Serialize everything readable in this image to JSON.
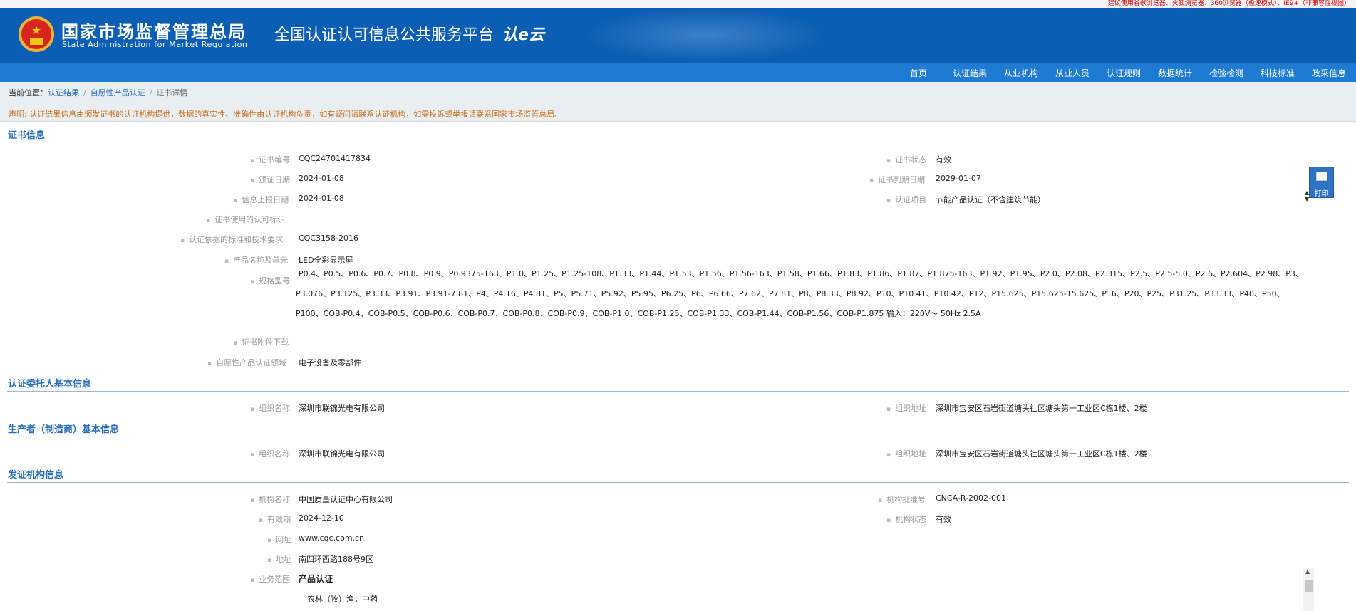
{
  "top_notice": "建议使用谷歌浏览器、火狐浏览器、360浏览器（极速模式）、IE9+（非兼容性视图）",
  "header": {
    "agency_cn": "国家市场监督管理总局",
    "agency_en": "State Administration for Market Regulation",
    "platform": "全国认证认可信息公共服务平台",
    "logo_text": "认e云"
  },
  "nav": [
    "首页",
    "认证结果",
    "从业机构",
    "从业人员",
    "认证规则",
    "数据统计",
    "检验检测",
    "科技标准",
    "政采信息"
  ],
  "breadcrumb": {
    "prefix": "当前位置：",
    "items": [
      "认证结果",
      "自愿性产品认证",
      "证书详情"
    ]
  },
  "declaration": "声明: 认证结果信息由颁发证书的认证机构提供，数据的真实性、准确性由认证机构负责，如有疑问请联系认证机构，如需投诉或举报请联系国家市场监管总局。",
  "print_label": "打印",
  "cert_info": {
    "title": "证书信息",
    "cert_no_label": "证书编号",
    "cert_no": "CQC24701417834",
    "status_label": "证书状态",
    "status": "有效",
    "issue_date_label": "颁证日期",
    "issue_date": "2024-01-08",
    "expire_date_label": "证书到期日期",
    "expire_date": "2029-01-07",
    "report_date_label": "信息上报日期",
    "report_date": "2024-01-08",
    "project_label": "认证项目",
    "project": "节能产品认证（不含建筑节能）",
    "mark_label": "证书使用的认可标识",
    "mark": "",
    "standard_label": "认证依据的标准和技术要求",
    "standard": "CQC3158-2016",
    "product_label": "产品名称及单元",
    "product": "LED全彩显示屏",
    "model_label": "规格型号",
    "model": "P0.4、P0.5、P0.6、P0.7、P0.8、P0.9、P0.9375-163、P1.0、P1.25、P1.25-108、P1.33、P1.44、P1.53、P1.56、P1.56-163、P1.58、P1.66、P1.83、P1.86、P1.87、P1.875-163、P1.92、P1.95、P2.0、P2.08、P2.315、P2.5、P2.5-5.0、P2.6、P2.604、P2.98、P3、P3.076、P3.125、P3.33、P3.91、P3.91-7.81、P4、P4.16、P4.81、P5、P5.71、P5.92、P5.95、P6.25、P6、P6.66、P7.62、P7.81、P8、P8.33、P8.92、P10、P10.41、P10.42、P12、P15.625、P15.625-15.625、P16、P20、P25、P31.25、P33.33、P40、P50、P100、COB-P0.4、COB-P0.5、COB-P0.6、COB-P0.7、COB-P0.8、COB-P0.9、COB-P1.0、COB-P1.25、COB-P1.33、COB-P1.44、COB-P1.56、COB-P1.875 输入：220V～ 50Hz 2.5A",
    "attachment_label": "证书附件下载",
    "attachment": "",
    "field_label": "自愿性产品认证领域",
    "field": "电子设备及零部件"
  },
  "client_info": {
    "title": "认证委托人基本信息",
    "org_label": "组织名称",
    "org": "深圳市联锦光电有限公司",
    "addr_label": "组织地址",
    "addr": "深圳市宝安区石岩街道塘头社区塘头第一工业区C栋1楼、2楼"
  },
  "maker_info": {
    "title": "生产者（制造商）基本信息",
    "org_label": "组织名称",
    "org": "深圳市联锦光电有限公司",
    "addr_label": "组织地址",
    "addr": "深圳市宝安区石岩街道塘头社区塘头第一工业区C栋1楼、2楼"
  },
  "issuer_info": {
    "title": "发证机构信息",
    "name_label": "机构名称",
    "name": "中国质量认证中心有限公司",
    "approval_label": "机构批准号",
    "approval": "CNCA-R-2002-001",
    "valid_label": "有效期",
    "valid": "2024-12-10",
    "org_status_label": "机构状态",
    "org_status": "有效",
    "website_label": "网址",
    "website": "www.cqc.com.cn",
    "address_label": "地址",
    "address": "南四环西路188号9区",
    "scope_label": "业务范围",
    "scope": "产品认证",
    "scope_item": "农林（牧）渔；中药"
  }
}
